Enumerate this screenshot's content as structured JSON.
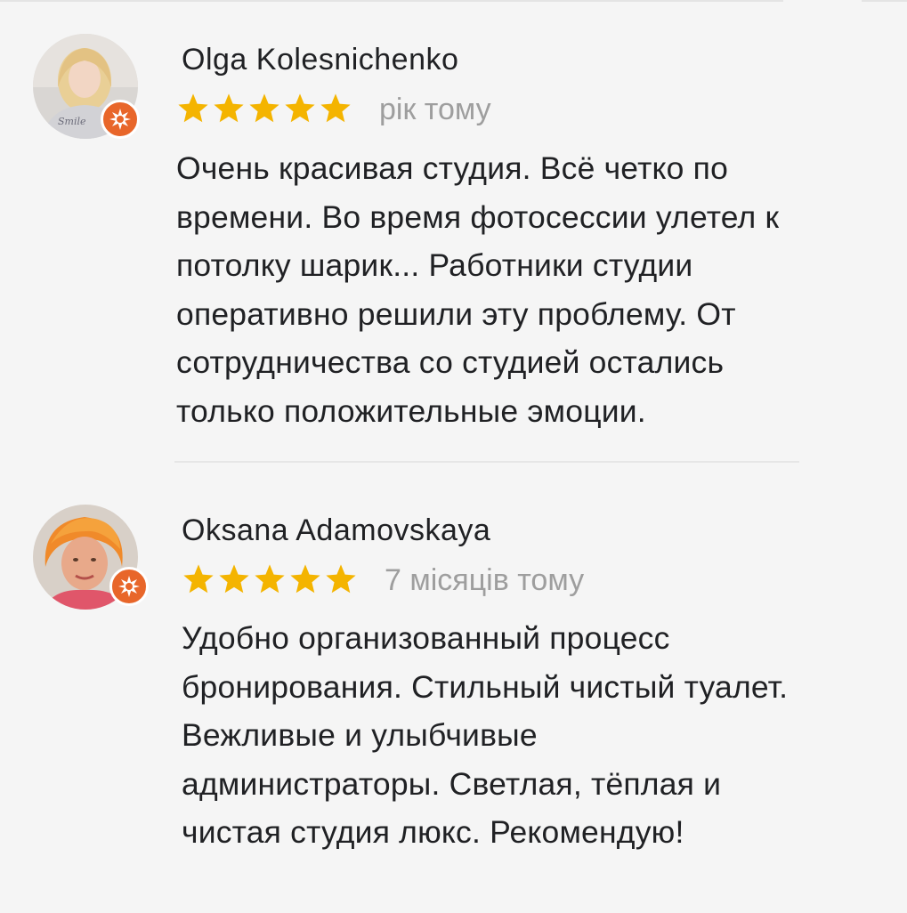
{
  "reviews": [
    {
      "author": "Olga Kolesnichenko",
      "rating": 5,
      "time": "рік тому",
      "text_lines": [
        "Очень красивая студия. Всё четко по",
        "времени. Во время фотосессии улетел к",
        "потолку шарик... Работники студии",
        "оперативно решили эту проблему. От",
        "сотрудничества со студией остались",
        "только положительные эмоции."
      ],
      "avatar_icon": "user-photo-avatar",
      "badge_icon": "local-guide-badge-icon"
    },
    {
      "author": "Oksana Adamovskaya",
      "rating": 5,
      "time": "7 місяців тому",
      "text_lines": [
        "Удобно организованный процесс",
        "бронирования. Стильный чистый туалет.",
        "Вежливые и улыбчивые",
        "администраторы. Светлая, тёплая и",
        "чистая студия люкс. Рекомендую!"
      ],
      "avatar_icon": "user-photo-avatar",
      "badge_icon": "local-guide-badge-icon"
    }
  ],
  "colors": {
    "background": "#f5f5f5",
    "star": "#f4b400",
    "badge": "#e8662a",
    "author_text": "#202124",
    "time_text": "#9e9e9e"
  }
}
